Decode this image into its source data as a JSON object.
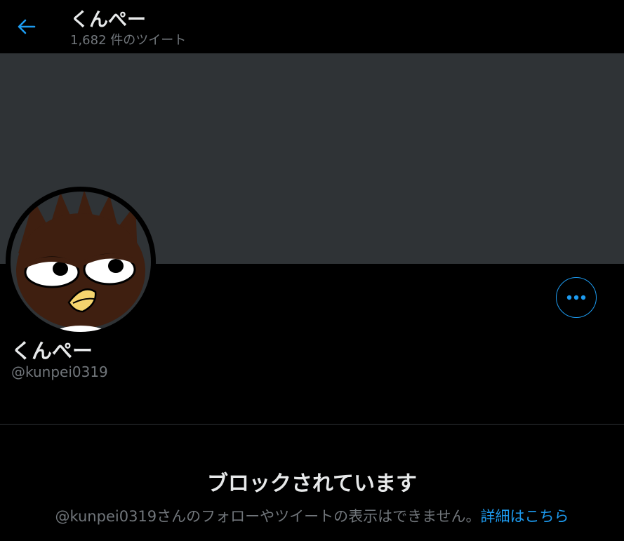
{
  "header": {
    "title": "くんぺー",
    "tweet_count": "1,682 件のツイート",
    "back_icon": "arrow-left-icon"
  },
  "profile": {
    "display_name": "くんぺー",
    "handle": "@kunpei0319",
    "more_icon": "ellipsis-icon"
  },
  "blocked": {
    "title": "ブロックされています",
    "message": "@kunpei0319さんのフォローやツイートの表示はできません。",
    "link_label": "詳細はこちら"
  },
  "colors": {
    "accent": "#1d9bf0",
    "background": "#000000",
    "banner": "#2f3336",
    "primary_text": "#e7e9ea",
    "secondary_text": "#71767b"
  }
}
